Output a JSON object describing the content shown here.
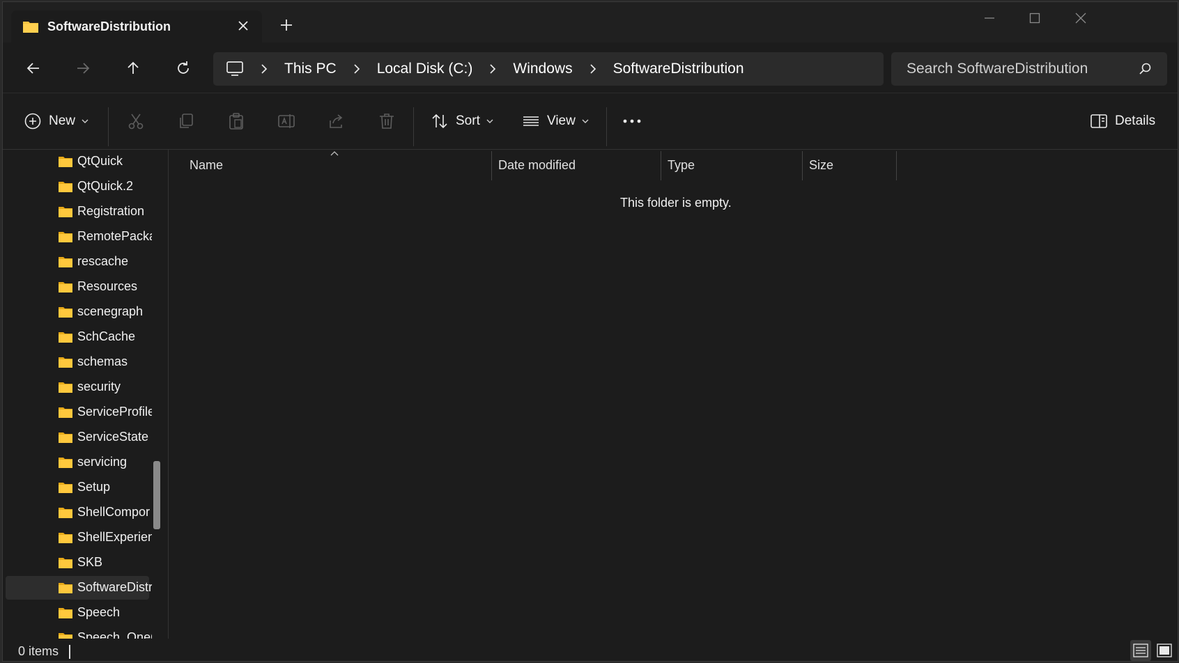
{
  "tab": {
    "title": "SoftwareDistribution"
  },
  "breadcrumb": [
    "This PC",
    "Local Disk (C:)",
    "Windows",
    "SoftwareDistribution"
  ],
  "search": {
    "placeholder": "Search SoftwareDistribution"
  },
  "commands": {
    "new": "New",
    "sort": "Sort",
    "view": "View",
    "details": "Details"
  },
  "sidebar": {
    "items": [
      {
        "label": "QtQuick"
      },
      {
        "label": "QtQuick.2"
      },
      {
        "label": "Registration"
      },
      {
        "label": "RemotePacka"
      },
      {
        "label": "rescache"
      },
      {
        "label": "Resources"
      },
      {
        "label": "scenegraph"
      },
      {
        "label": "SchCache"
      },
      {
        "label": "schemas"
      },
      {
        "label": "security"
      },
      {
        "label": "ServiceProfile"
      },
      {
        "label": "ServiceState"
      },
      {
        "label": "servicing"
      },
      {
        "label": "Setup"
      },
      {
        "label": "ShellCompor"
      },
      {
        "label": "ShellExperien"
      },
      {
        "label": "SKB"
      },
      {
        "label": "SoftwareDistri",
        "selected": true
      },
      {
        "label": "Speech"
      },
      {
        "label": "Speech_OneC"
      }
    ]
  },
  "columns": {
    "name": "Name",
    "date": "Date modified",
    "type": "Type",
    "size": "Size"
  },
  "content": {
    "empty_message": "This folder is empty."
  },
  "status": {
    "items": "0 items"
  },
  "colors": {
    "folder": "#f5c242",
    "background": "#1c1c1c",
    "selected": "#2d2d2d"
  }
}
